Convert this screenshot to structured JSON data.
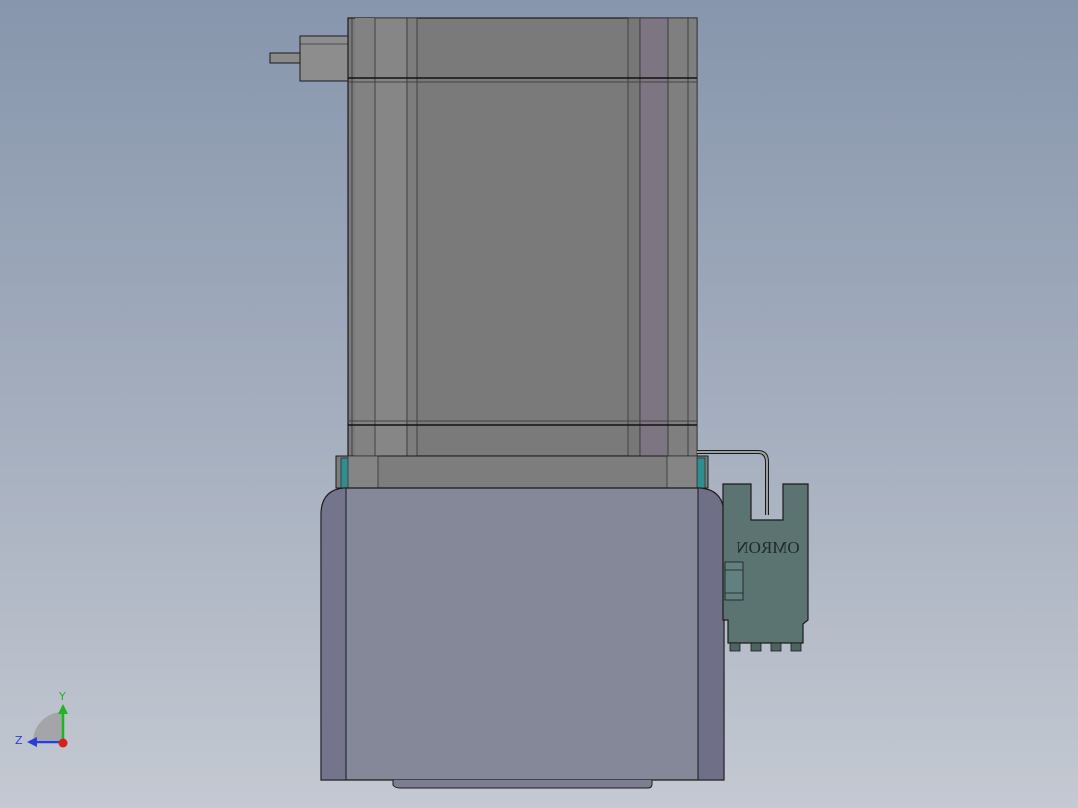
{
  "model": {
    "sensor_brand": "OMRON"
  },
  "triad": {
    "y_label": "Y",
    "z_label": "Z"
  },
  "colors": {
    "motor_body": "#7a7a7a",
    "motor_edge": "#1a1a1a",
    "gearbox_body": "#848899",
    "gearbox_side": "#6f6f87",
    "sensor_body": "#5b7472",
    "axis_y": "#1fb51f",
    "axis_z": "#2b3fd6",
    "axis_x": "#d61f1f"
  }
}
